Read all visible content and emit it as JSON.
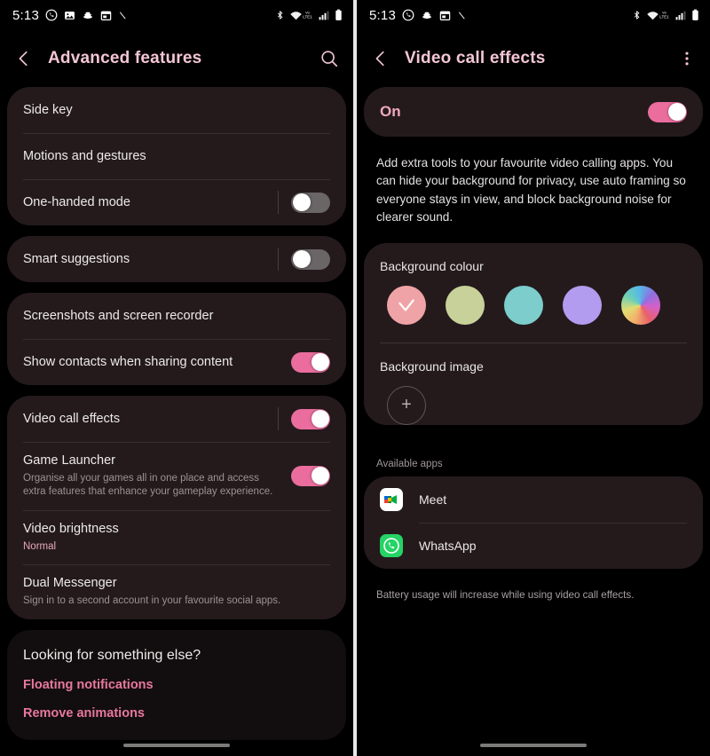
{
  "theme": {
    "accent_pink": "#e8789f",
    "title_pink": "#f3c6d4",
    "card_bg": "#241a1c",
    "screen_bg": "#000000",
    "toggle_on": "#ea6d9e",
    "toggle_off": "#6a6566"
  },
  "left": {
    "statusbar": {
      "time": "5:13",
      "left_icons": [
        "whatsapp-icon",
        "gallery-image-icon",
        "stack-layers-icon",
        "calendar-icon",
        "slash-icon"
      ],
      "right_icons": [
        "bluetooth-icon",
        "wifi-volte-icon",
        "signal-bars-icon",
        "battery-icon"
      ],
      "volte_label": "VoLTE1"
    },
    "appbar": {
      "back_icon": "back-chevron-icon",
      "title": "Advanced features",
      "search_icon": "search-icon"
    },
    "cards": [
      {
        "rows": [
          {
            "label": "Side key",
            "sub": "",
            "toggle": null
          },
          {
            "label": "Motions and gestures",
            "sub": "",
            "toggle": null
          },
          {
            "label": "One-handed mode",
            "sub": "",
            "toggle": "off"
          }
        ]
      },
      {
        "rows": [
          {
            "label": "Smart suggestions",
            "sub": "",
            "toggle": "off"
          }
        ]
      },
      {
        "rows": [
          {
            "label": "Screenshots and screen recorder",
            "sub": "",
            "toggle": null
          },
          {
            "label": "Show contacts when sharing content",
            "sub": "",
            "toggle": "on_nosep"
          }
        ]
      },
      {
        "rows": [
          {
            "label": "Video call effects",
            "sub": "",
            "toggle": "on"
          },
          {
            "label": "Game Launcher",
            "sub": "Organise all your games all in one place and access extra features that enhance your gameplay experience.",
            "toggle": "on_nosep"
          },
          {
            "label": "Video brightness",
            "sub": "Normal",
            "sub_accent": true,
            "toggle": null
          },
          {
            "label": "Dual Messenger",
            "sub": "Sign in to a second account in your favourite social apps.",
            "toggle": null
          }
        ]
      }
    ],
    "looking": {
      "title": "Looking for something else?",
      "links": [
        "Floating notifications",
        "Remove animations"
      ]
    }
  },
  "right": {
    "statusbar": {
      "time": "5:13",
      "left_icons": [
        "whatsapp-icon",
        "stack-layers-icon",
        "calendar-icon",
        "slash-icon"
      ],
      "right_icons": [
        "bluetooth-icon",
        "wifi-volte-icon",
        "signal-bars-icon",
        "battery-icon"
      ],
      "volte_label": "VoLTE1"
    },
    "appbar": {
      "back_icon": "back-chevron-icon",
      "title": "Video call effects",
      "menu_icon": "overflow-menu-icon"
    },
    "master_switch": {
      "label": "On",
      "state": "on"
    },
    "description": "Add extra tools to your favourite video calling apps. You can hide your background for privacy, use auto framing so everyone stays in view, and block background noise for clearer sound.",
    "background_colour": {
      "title": "Background colour",
      "swatches": [
        {
          "name": "pink",
          "color": "#f0a3a6",
          "selected": true
        },
        {
          "name": "sage-green",
          "color": "#c7d199",
          "selected": false
        },
        {
          "name": "teal",
          "color": "#7ccdcb",
          "selected": false
        },
        {
          "name": "purple",
          "color": "#b29cef",
          "selected": false
        },
        {
          "name": "rainbow",
          "color": "rainbow",
          "selected": false
        }
      ]
    },
    "background_image": {
      "title": "Background image",
      "add_label": "+"
    },
    "available_apps": {
      "header": "Available apps",
      "apps": [
        {
          "name": "Meet",
          "icon": "google-meet-icon"
        },
        {
          "name": "WhatsApp",
          "icon": "whatsapp-icon"
        }
      ]
    },
    "footnote": "Battery usage will increase while using video call effects."
  }
}
